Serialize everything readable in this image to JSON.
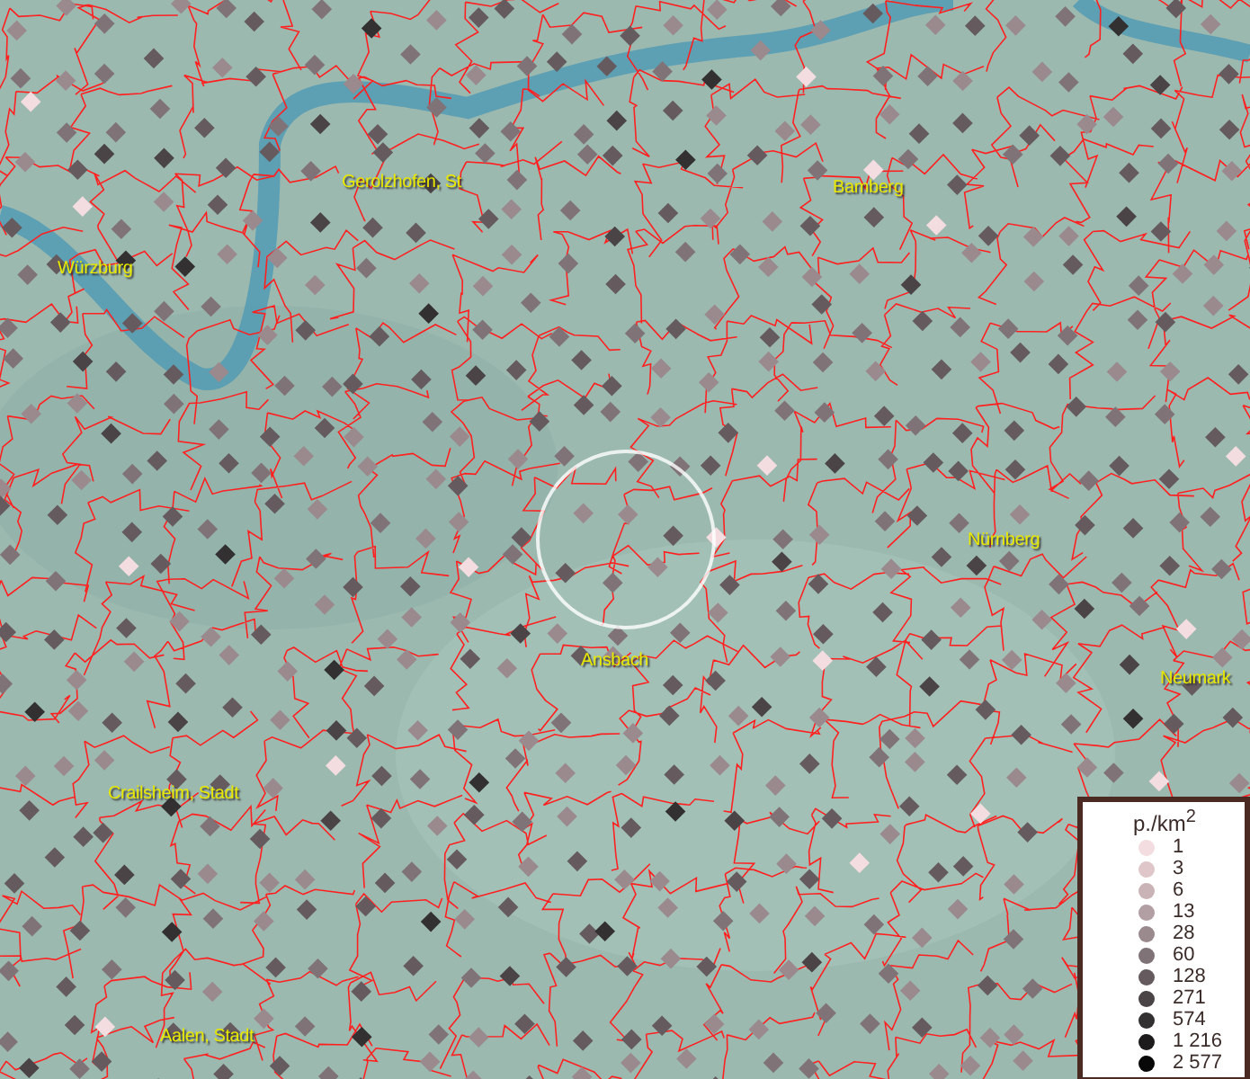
{
  "map": {
    "places": [
      {
        "name": "Gerolzhofen, St"
      },
      {
        "name": "Bamberg"
      },
      {
        "name": "Würzburg"
      },
      {
        "name": "Nürnberg"
      },
      {
        "name": "Ansbach"
      },
      {
        "name": "Neumark"
      },
      {
        "name": "Crailsheim, Stadt"
      },
      {
        "name": "Aalen, Stadt"
      }
    ]
  },
  "legend": {
    "title": "p./km$^{2}$",
    "items": [
      {
        "label": "1",
        "color": "#f3dde0"
      },
      {
        "label": "3",
        "color": "#dec6c9"
      },
      {
        "label": "6",
        "color": "#c9b3b6"
      },
      {
        "label": "13",
        "color": "#b29fa3"
      },
      {
        "label": "28",
        "color": "#9a8a8e"
      },
      {
        "label": "60",
        "color": "#807377"
      },
      {
        "label": "128",
        "color": "#655b5e"
      },
      {
        "label": "271",
        "color": "#4b4447"
      },
      {
        "label": "574",
        "color": "#333031"
      },
      {
        "label": "1 216",
        "color": "#1d1b1c"
      },
      {
        "label": "2 577",
        "color": "#080808"
      }
    ]
  }
}
